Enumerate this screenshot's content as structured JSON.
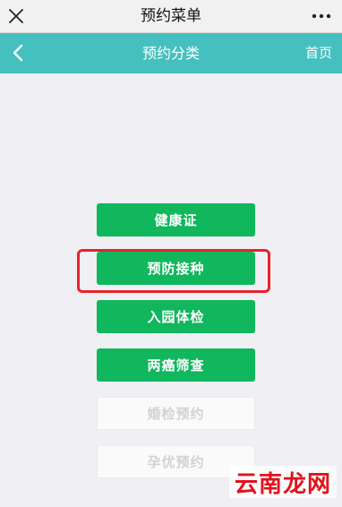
{
  "window": {
    "title": "预约菜单",
    "close_icon": "close-icon",
    "more_icon": "more-icon"
  },
  "navbar": {
    "title": "预约分类",
    "back_icon": "chevron-left-icon",
    "home_label": "首页",
    "color": "#46c0be"
  },
  "menu": {
    "items": [
      {
        "label": "健康证",
        "enabled": true
      },
      {
        "label": "预防接种",
        "enabled": true,
        "highlighted": true
      },
      {
        "label": "入园体检",
        "enabled": true
      },
      {
        "label": "两癌筛查",
        "enabled": true
      },
      {
        "label": "婚检预约",
        "enabled": false
      },
      {
        "label": "孕优预约",
        "enabled": false
      }
    ],
    "button_color": "#10b75d",
    "highlight_color": "#e6232b"
  },
  "watermark": {
    "text": "云南龙网"
  }
}
